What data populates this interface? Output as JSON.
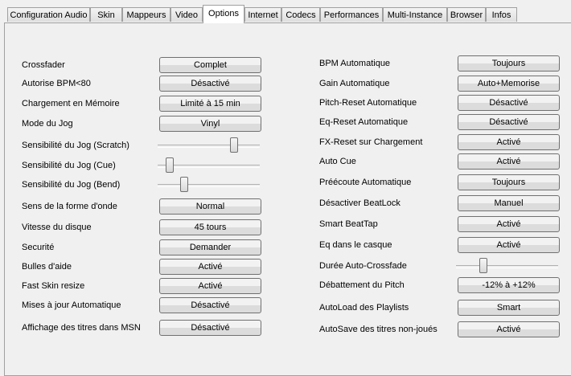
{
  "tabs": [
    "Configuration Audio",
    "Skin",
    "Mappeurs",
    "Video",
    "Options",
    "Internet",
    "Codecs",
    "Performances",
    "Multi-Instance",
    "Browser",
    "Infos"
  ],
  "selected_tab": "Options",
  "left": [
    {
      "label": "Crossfader",
      "type": "button",
      "value": "Complet"
    },
    {
      "label": "Autorise BPM<80",
      "type": "button",
      "value": "Désactivé"
    },
    {
      "label": "Chargement en Mémoire",
      "type": "button",
      "value": "Limité à 15 min"
    },
    {
      "label": "Mode du Jog",
      "type": "button",
      "value": "Vinyl"
    },
    {
      "label": "Sensibilité du Jog (Scratch)",
      "type": "slider",
      "value": 0.75
    },
    {
      "label": "Sensibilité du Jog (Cue)",
      "type": "slider",
      "value": 0.12
    },
    {
      "label": "Sensibilité du Jog (Bend)",
      "type": "slider",
      "value": 0.26
    },
    {
      "label": "Sens de la forme d'onde",
      "type": "button",
      "value": "Normal"
    },
    {
      "label": "Vitesse du disque",
      "type": "button",
      "value": "45 tours"
    },
    {
      "label": "Securité",
      "type": "button",
      "value": "Demander"
    },
    {
      "label": "Bulles d'aide",
      "type": "button",
      "value": "Activé"
    },
    {
      "label": "Fast Skin resize",
      "type": "button",
      "value": "Activé"
    },
    {
      "label": "Mises à jour Automatique",
      "type": "button",
      "value": "Désactivé"
    },
    {
      "label": "Affichage des titres dans MSN",
      "type": "button",
      "value": "Désactivé"
    }
  ],
  "right": [
    {
      "label": "BPM Automatique",
      "type": "button",
      "value": "Toujours"
    },
    {
      "label": "Gain Automatique",
      "type": "button",
      "value": "Auto+Memorise"
    },
    {
      "label": "Pitch-Reset Automatique",
      "type": "button",
      "value": "Désactivé"
    },
    {
      "label": "Eq-Reset Automatique",
      "type": "button",
      "value": "Désactivé"
    },
    {
      "label": "FX-Reset sur Chargement",
      "type": "button",
      "value": "Activé"
    },
    {
      "label": "Auto Cue",
      "type": "button",
      "value": "Activé"
    },
    {
      "label": "Préécoute Automatique",
      "type": "button",
      "value": "Toujours"
    },
    {
      "label": "Désactiver BeatLock",
      "type": "button",
      "value": "Manuel"
    },
    {
      "label": "Smart BeatTap",
      "type": "button",
      "value": "Activé"
    },
    {
      "label": "Eq dans le casque",
      "type": "button",
      "value": "Activé"
    },
    {
      "label": "Durée Auto-Crossfade",
      "type": "slider",
      "value": 0.27
    },
    {
      "label": "Débattement du Pitch",
      "type": "button",
      "value": "-12% à +12%"
    },
    {
      "label": "AutoLoad des Playlists",
      "type": "button",
      "value": "Smart"
    },
    {
      "label": "AutoSave des titres non-joués",
      "type": "button",
      "value": "Activé"
    }
  ]
}
